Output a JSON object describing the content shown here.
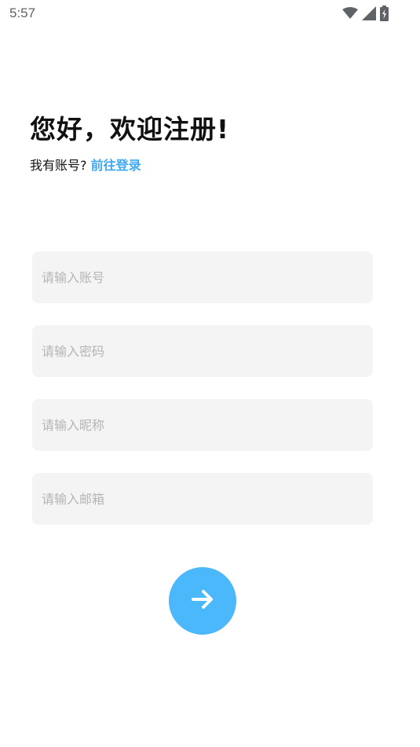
{
  "status_bar": {
    "time": "5:57",
    "icons": [
      "wifi-icon",
      "signal-icon",
      "battery-charging-icon"
    ]
  },
  "header": {
    "title": "您好，欢迎注册!",
    "subtitle_prefix": "我有账号?",
    "login_link": "前往登录"
  },
  "form": {
    "account_placeholder": "请输入账号",
    "password_placeholder": "请输入密码",
    "nickname_placeholder": "请输入昵称",
    "email_placeholder": "请输入邮箱"
  },
  "submit": {
    "icon": "arrow-right-icon"
  },
  "colors": {
    "accent": "#4bb8fb",
    "link": "#3fa9f5",
    "field_bg": "#f4f4f4"
  }
}
